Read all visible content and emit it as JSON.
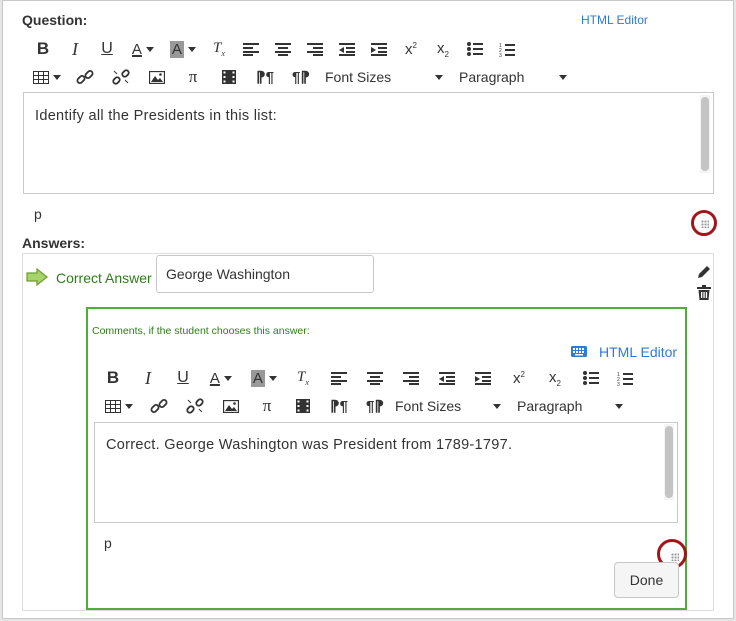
{
  "question": {
    "label": "Question:",
    "html_editor_label": "HTML Editor",
    "font_sizes_label": "Font Sizes",
    "paragraph_label": "Paragraph",
    "body_text": "Identify all the Presidents in this list:",
    "path": "p"
  },
  "answers": {
    "label": "Answers:",
    "correct_label": "Correct Answer",
    "answer_value": "George Washington",
    "comments": {
      "label": "Comments, if the student chooses this answer:",
      "html_editor_label": "HTML Editor",
      "font_sizes_label": "Font Sizes",
      "paragraph_label": "Paragraph",
      "body_text": "Correct. George Washington was President from 1789-1797.",
      "path": "p",
      "done_label": "Done"
    }
  },
  "colors": {
    "correct_green": "#2e7d16",
    "link_blue": "#2d7bd2",
    "highlight_ring": "#a0161b",
    "comments_border": "#4caf3a"
  },
  "toolbar_icons_row1": [
    "bold-icon",
    "italic-icon",
    "underline-icon",
    "text-color-icon",
    "background-color-icon",
    "clear-formatting-icon",
    "align-left-icon",
    "align-center-icon",
    "align-right-icon",
    "outdent-icon",
    "indent-icon",
    "superscript-icon",
    "subscript-icon",
    "bullet-list-icon",
    "numbered-list-icon"
  ],
  "toolbar_icons_row2": [
    "table-icon",
    "link-icon",
    "unlink-icon",
    "image-icon",
    "math-pi-icon",
    "media-icon",
    "ltr-icon",
    "rtl-icon"
  ]
}
